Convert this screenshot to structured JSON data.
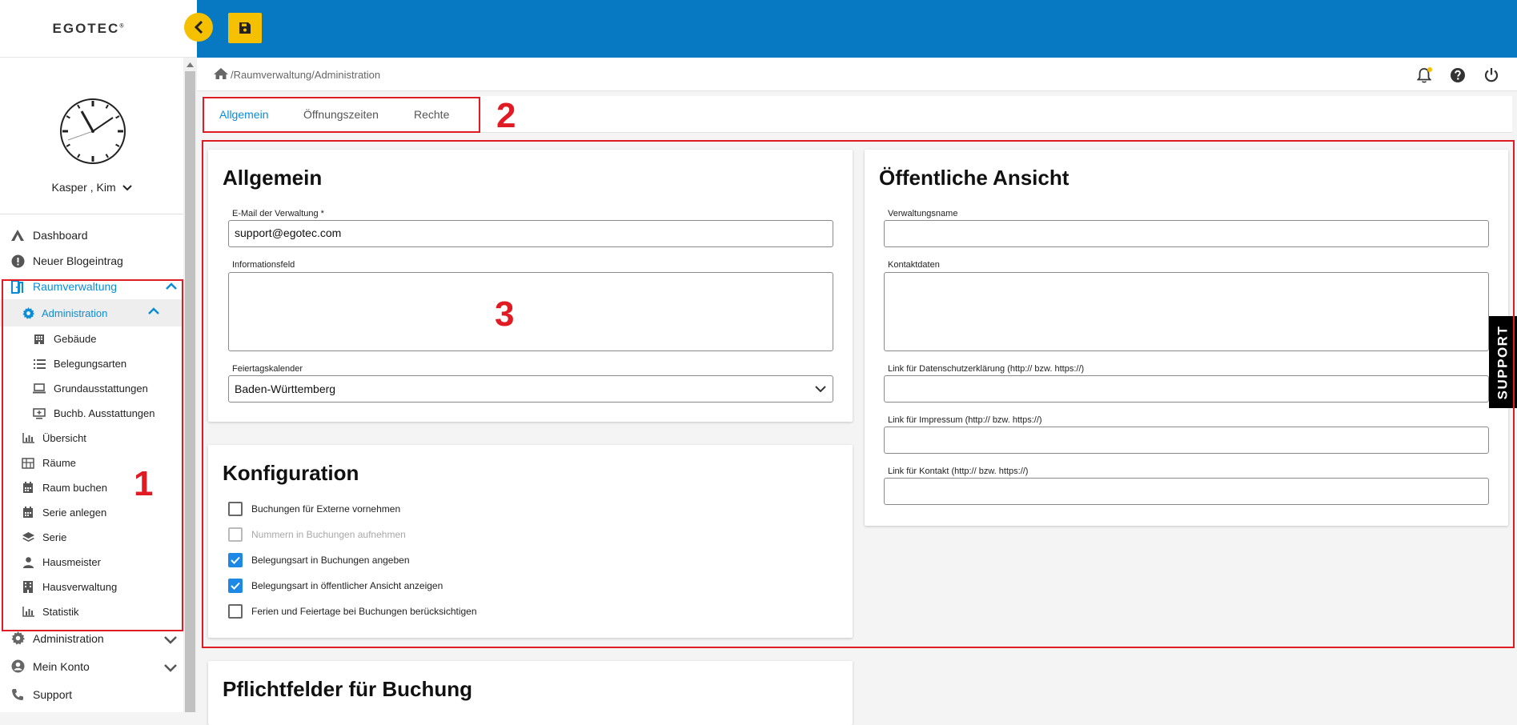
{
  "app": {
    "logo": "EGOTEC",
    "logo_mark": "®"
  },
  "user": {
    "name": "Kasper , Kim"
  },
  "sidebar": {
    "items": [
      {
        "label": "Dashboard",
        "icon": "tent-icon"
      },
      {
        "label": "Neuer Blogeintrag",
        "icon": "alert-circle-icon"
      },
      {
        "label": "Raumverwaltung",
        "icon": "door-icon",
        "state": "active-expanded"
      },
      {
        "label": "Administration",
        "icon": "gear-icon",
        "state": "active-expanded"
      },
      {
        "label": "Gebäude",
        "icon": "building-icon"
      },
      {
        "label": "Belegungsarten",
        "icon": "list-icon"
      },
      {
        "label": "Grundausstattungen",
        "icon": "laptop-icon"
      },
      {
        "label": "Buchb. Ausstattungen",
        "icon": "monitor-plus-icon"
      },
      {
        "label": "Übersicht",
        "icon": "chart-icon"
      },
      {
        "label": "Räume",
        "icon": "floorplan-icon"
      },
      {
        "label": "Raum buchen",
        "icon": "calendar-icon"
      },
      {
        "label": "Serie anlegen",
        "icon": "calendar-icon"
      },
      {
        "label": "Serie",
        "icon": "layers-icon"
      },
      {
        "label": "Hausmeister",
        "icon": "person-icon"
      },
      {
        "label": "Hausverwaltung",
        "icon": "building-icon"
      },
      {
        "label": "Statistik",
        "icon": "chart-icon"
      },
      {
        "label": "Administration",
        "icon": "gear-icon"
      },
      {
        "label": "Mein Konto",
        "icon": "account-icon"
      },
      {
        "label": "Support",
        "icon": "phone-icon"
      }
    ]
  },
  "breadcrumb": "/Raumverwaltung/Administration",
  "tabs": [
    {
      "label": "Allgemein",
      "active": true
    },
    {
      "label": "Öffnungszeiten",
      "active": false
    },
    {
      "label": "Rechte",
      "active": false
    }
  ],
  "annotations": [
    "1",
    "2",
    "3"
  ],
  "allgemein": {
    "title": "Allgemein",
    "email_label": "E-Mail der Verwaltung *",
    "email_value": "support@egotec.com",
    "info_label": "Informationsfeld",
    "holiday_label": "Feiertagskalender",
    "holiday_value": "Baden-Württemberg"
  },
  "konfiguration": {
    "title": "Konfiguration",
    "options": [
      {
        "label": "Buchungen für Externe vornehmen",
        "checked": false,
        "disabled": false
      },
      {
        "label": "Nummern in Buchungen aufnehmen",
        "checked": false,
        "disabled": true
      },
      {
        "label": "Belegungsart in Buchungen angeben",
        "checked": true,
        "disabled": false
      },
      {
        "label": "Belegungsart in öffentlicher Ansicht anzeigen",
        "checked": true,
        "disabled": false
      },
      {
        "label": "Ferien und Feiertage bei Buchungen berücksichtigen",
        "checked": false,
        "disabled": false
      }
    ]
  },
  "oeffentlich": {
    "title": "Öffentliche Ansicht",
    "name_label": "Verwaltungsname",
    "kontakt_label": "Kontaktdaten",
    "datenschutz_label": "Link für Datenschutzerklärung (http:// bzw. https://)",
    "impressum_label": "Link für Impressum (http:// bzw. https://)",
    "kontaktlink_label": "Link für Kontakt (http:// bzw. https://)"
  },
  "pflicht": {
    "title": "Pflichtfelder für Buchung"
  },
  "support_tab": "SUPPORT",
  "colors": {
    "topbar": "#0779c2",
    "accent_yellow": "#f5c000",
    "active_blue": "#0a8dd6",
    "annotation_red": "#e01b24"
  }
}
